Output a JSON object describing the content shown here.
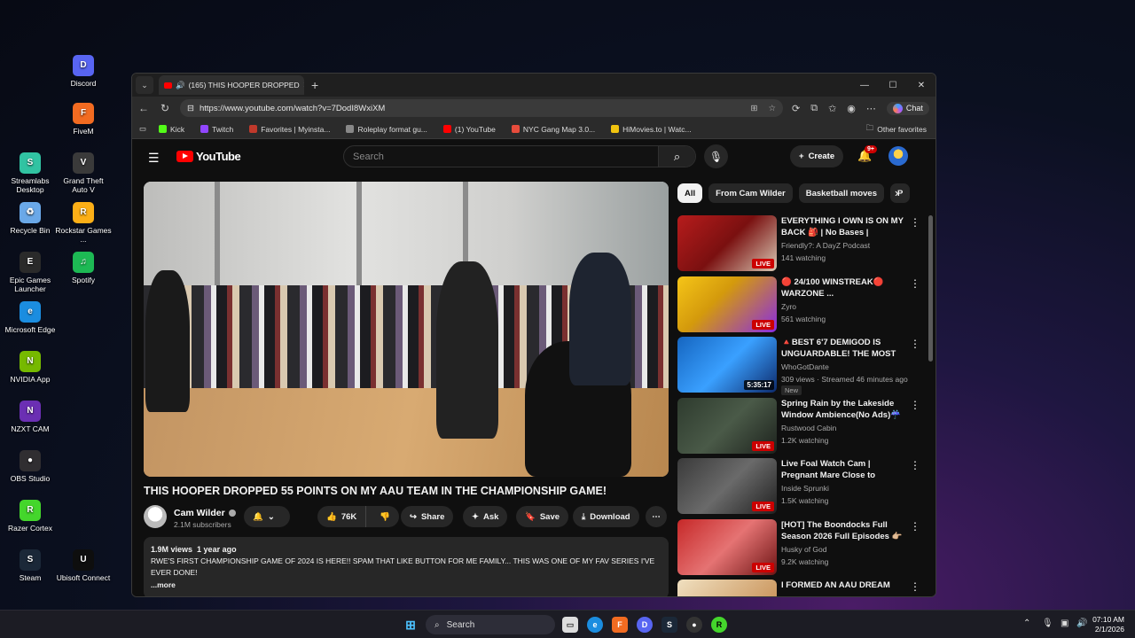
{
  "desktop": {
    "icons": [
      {
        "label": "Discord",
        "color": "#5865F2",
        "glyph": "D"
      },
      {
        "label": "FiveM",
        "color": "#f26b21",
        "glyph": "F"
      },
      {
        "label": "Streamlabs Desktop",
        "color": "#31c3a2",
        "glyph": "S"
      },
      {
        "label": "Grand Theft Auto V",
        "color": "#3a3a3a",
        "glyph": "V"
      },
      {
        "label": "Recycle Bin",
        "color": "#6aa8e8",
        "glyph": "♻"
      },
      {
        "label": "Rockstar Games ...",
        "color": "#fcaf17",
        "glyph": "R"
      },
      {
        "label": "Epic Games Launcher",
        "color": "#2a2a2a",
        "glyph": "E"
      },
      {
        "label": "Spotify",
        "color": "#1db954",
        "glyph": "♫"
      },
      {
        "label": "Microsoft Edge",
        "color": "#1b8de0",
        "glyph": "e"
      },
      {
        "label": "NVIDIA App",
        "color": "#76b900",
        "glyph": "N"
      },
      {
        "label": "NZXT CAM",
        "color": "#6b2fb3",
        "glyph": "N"
      },
      {
        "label": "OBS Studio",
        "color": "#302e31",
        "glyph": "●"
      },
      {
        "label": "Razer Cortex",
        "color": "#44d62c",
        "glyph": "R"
      },
      {
        "label": "Steam",
        "color": "#1b2838",
        "glyph": "S"
      },
      {
        "label": "Ubisoft Connect",
        "color": "#0e0e0e",
        "glyph": "U"
      }
    ]
  },
  "browser": {
    "tab_title": "(165) THIS HOOPER DROPPED",
    "url": "https://www.youtube.com/watch?v=7DodI8WxiXM",
    "chat_label": "Chat",
    "favorites": [
      "Kick",
      "Twitch",
      "Favorites | Myinsta...",
      "Roleplay format gu...",
      "(1) YouTube",
      "NYC Gang Map 3.0...",
      "HiMovies.to | Watc..."
    ],
    "favorite_colors": [
      "#53fc18",
      "#9146ff",
      "#c0392b",
      "#888888",
      "#ff0000",
      "#e74c3c",
      "#f1c40f"
    ],
    "other_favorites": "Other favorites"
  },
  "youtube": {
    "logo": "YouTube",
    "search_placeholder": "Search",
    "create_label": "Create",
    "notif_badge": "9+",
    "video": {
      "title": "THIS HOOPER DROPPED 55 POINTS ON MY AAU TEAM IN THE CHAMPIONSHIP GAME!",
      "channel": "Cam Wilder",
      "subscribers": "2.1M subscribers",
      "likes": "76K",
      "share": "Share",
      "ask": "Ask",
      "save": "Save",
      "download": "Download",
      "views": "1.9M views",
      "age": "1 year ago",
      "description": "RWE'S FIRST CHAMPIONSHIP GAME OF 2024 IS HERE!! SPAM THAT LIKE BUTTON FOR ME FAMILY... THIS WAS ONE OF MY FAV SERIES I'VE EVER DONE!",
      "more": "...more"
    },
    "chips": [
      "All",
      "From Cam Wilder",
      "Basketball moves",
      "P"
    ],
    "recommendations": [
      {
        "title": "EVERYTHING I OWN IS ON MY BACK 🎒 | No Bases | Hardcor...",
        "channel": "Friendly?: A DayZ Podcast",
        "meta": "141 watching",
        "badge": "LIVE",
        "thumb": "linear-gradient(135deg,#b71c1c,#7a1010 50%,#d9c8b4)"
      },
      {
        "title": "🔴 24/100 WINSTREAK🔴 WARZONE ...",
        "channel": "Zyro",
        "meta": "561 watching",
        "badge": "LIVE",
        "thumb": "linear-gradient(135deg,#f5c518,#d49a0c 40%,#8a2be2)"
      },
      {
        "title": "🔺BEST 6'7 DEMIGOD IS UNGUARDABLE! THE MOST ...",
        "channel": "WhoGotDante",
        "meta": "309 views · Streamed 46 minutes ago",
        "badge": "5:35:17",
        "new": "New",
        "thumb": "linear-gradient(135deg,#1565c0,#3aa0ff 50%,#0d2a6b)"
      },
      {
        "title": "Spring Rain by the Lakeside Window Ambience(No Ads)☔ ...",
        "channel": "Rustwood Cabin",
        "meta": "1.2K watching",
        "badge": "LIVE",
        "thumb": "linear-gradient(135deg,#2e3b2e,#4a5a48 50%,#1d221d)"
      },
      {
        "title": "Live Foal Watch Cam | Pregnant Mare Close to Foaling — ...",
        "channel": "Inside Sprunki",
        "meta": "1.5K watching",
        "badge": "LIVE",
        "thumb": "linear-gradient(135deg,#3a3a3a,#6a6a6a 50%,#202020)"
      },
      {
        "title": "[HOT] The Boondocks Full Season 2026 Full Episodes 👉🏼 ...",
        "channel": "Husky of God",
        "meta": "9.2K watching",
        "badge": "LIVE",
        "thumb": "linear-gradient(135deg,#c62828,#e57373 50%,#6d1414)"
      },
      {
        "title": "I FORMED AN AAU DREAM",
        "channel": "",
        "meta": "",
        "badge": "",
        "thumb": "linear-gradient(135deg,#f0e0c0,#c08040)"
      }
    ]
  },
  "taskbar": {
    "search_label": "Search",
    "time": "07:10 AM",
    "date": "2/1/2026"
  }
}
